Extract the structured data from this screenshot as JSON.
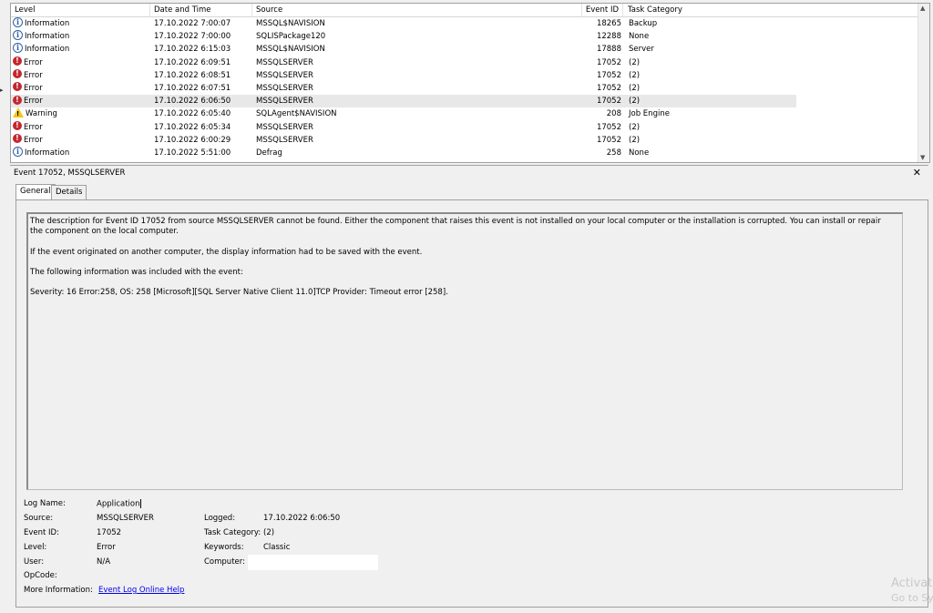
{
  "columns": {
    "level": "Level",
    "date_time": "Date and Time",
    "source": "Source",
    "event_id": "Event ID",
    "task_category": "Task Category"
  },
  "events": [
    {
      "level": "Information",
      "icon": "info-icon",
      "date": "17.10.2022 7:00:07",
      "source": "MSSQL$NAVISION",
      "event_id": "18265",
      "task": "Backup"
    },
    {
      "level": "Information",
      "icon": "info-icon",
      "date": "17.10.2022 7:00:00",
      "source": "SQLISPackage120",
      "event_id": "12288",
      "task": "None"
    },
    {
      "level": "Information",
      "icon": "info-icon",
      "date": "17.10.2022 6:15:03",
      "source": "MSSQL$NAVISION",
      "event_id": "17888",
      "task": "Server"
    },
    {
      "level": "Error",
      "icon": "error-icon",
      "date": "17.10.2022 6:09:51",
      "source": "MSSQLSERVER",
      "event_id": "17052",
      "task": "(2)"
    },
    {
      "level": "Error",
      "icon": "error-icon",
      "date": "17.10.2022 6:08:51",
      "source": "MSSQLSERVER",
      "event_id": "17052",
      "task": "(2)"
    },
    {
      "level": "Error",
      "icon": "error-icon",
      "date": "17.10.2022 6:07:51",
      "source": "MSSQLSERVER",
      "event_id": "17052",
      "task": "(2)"
    },
    {
      "level": "Error",
      "icon": "error-icon",
      "date": "17.10.2022 6:06:50",
      "source": "MSSQLSERVER",
      "event_id": "17052",
      "task": "(2)",
      "selected": true
    },
    {
      "level": "Warning",
      "icon": "warning-icon",
      "date": "17.10.2022 6:05:40",
      "source": "SQLAgent$NAVISION",
      "event_id": "208",
      "task": "Job Engine"
    },
    {
      "level": "Error",
      "icon": "error-icon",
      "date": "17.10.2022 6:05:34",
      "source": "MSSQLSERVER",
      "event_id": "17052",
      "task": "(2)"
    },
    {
      "level": "Error",
      "icon": "error-icon",
      "date": "17.10.2022 6:00:29",
      "source": "MSSQLSERVER",
      "event_id": "17052",
      "task": "(2)"
    },
    {
      "level": "Information",
      "icon": "info-icon",
      "date": "17.10.2022 5:51:00",
      "source": "Defrag",
      "event_id": "258",
      "task": "None"
    }
  ],
  "detail": {
    "title": "Event 17052, MSSQLSERVER",
    "close_glyph": "✕",
    "tabs": {
      "general": "General",
      "details": "Details"
    },
    "description": [
      "The description for Event ID 17052 from source MSSQLSERVER cannot be found. Either the component that raises this event is not installed on your local computer or the installation is corrupted. You can install or repair the component on the local computer.",
      "If the event originated on another computer, the display information had to be saved with the event.",
      "The following information was included with the event:",
      "Severity: 16 Error:258, OS: 258 [Microsoft][SQL Server Native Client 11.0]TCP Provider: Timeout error [258]."
    ],
    "fields": {
      "log_name_label": "Log Name:",
      "log_name": "Application",
      "source_label": "Source:",
      "source": "MSSQLSERVER",
      "event_id_label": "Event ID:",
      "event_id": "17052",
      "level_label": "Level:",
      "level": "Error",
      "user_label": "User:",
      "user": "N/A",
      "opcode_label": "OpCode:",
      "opcode": "",
      "more_info_label": "More Information:",
      "more_info_link": "Event Log Online Help",
      "logged_label": "Logged:",
      "logged": "17.10.2022 6:06:50",
      "task_category_label": "Task Category:",
      "task_category": "(2)",
      "keywords_label": "Keywords:",
      "keywords": "Classic",
      "computer_label": "Computer:",
      "computer": ""
    }
  },
  "watermark": {
    "line1": "Activat",
    "line2": "Go to Sys"
  },
  "colors": {
    "error": "#c4262e",
    "info": "#2b5fa8",
    "warning": "#f4c518",
    "link": "#0000ee"
  }
}
